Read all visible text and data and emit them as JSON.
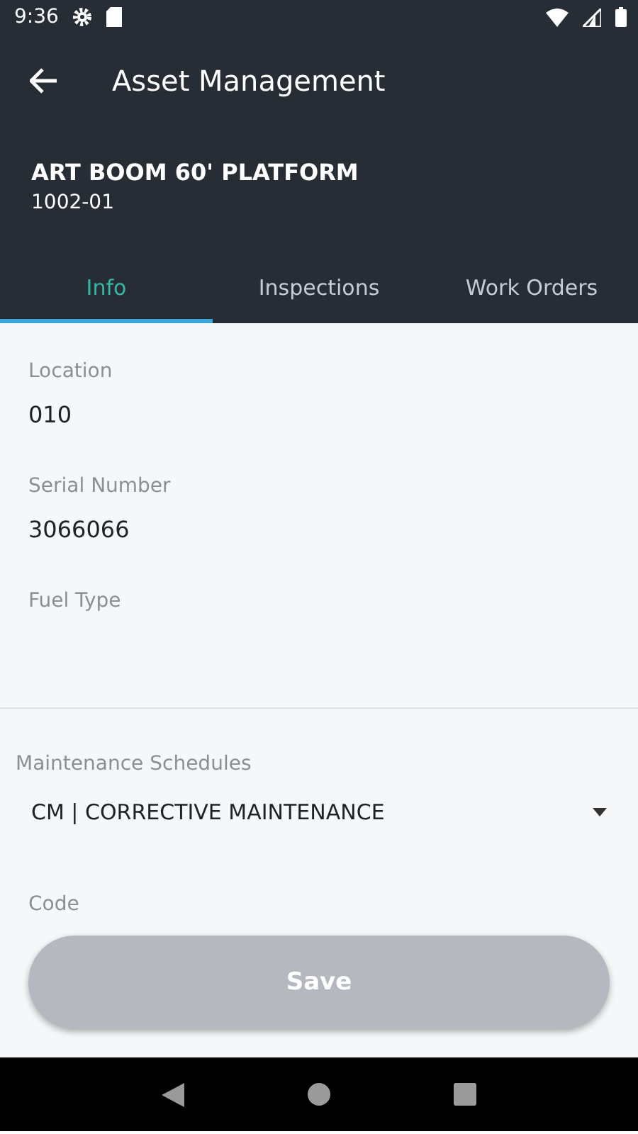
{
  "status_bar": {
    "time": "9:36"
  },
  "toolbar": {
    "title": "Asset Management"
  },
  "asset": {
    "name": "ART BOOM 60' PLATFORM",
    "number": "1002-01"
  },
  "tabs": [
    {
      "label": "Info",
      "selected": true
    },
    {
      "label": "Inspections",
      "selected": false
    },
    {
      "label": "Work Orders",
      "selected": false
    }
  ],
  "fields": [
    {
      "label": "Location",
      "value": "010"
    },
    {
      "label": "Serial Number",
      "value": "3066066"
    },
    {
      "label": "Fuel Type"
    }
  ],
  "maintenance": {
    "label": "Maintenance Schedules",
    "value": "CM | CORRECTIVE MAINTENANCE"
  },
  "code_field": {
    "label": "Code"
  },
  "save_button": {
    "label": "Save",
    "disabled": true
  }
}
